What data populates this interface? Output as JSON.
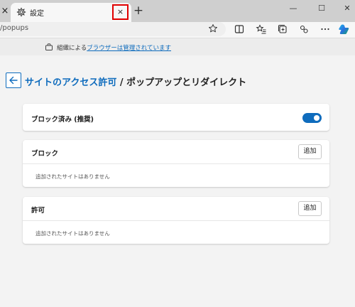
{
  "browser": {
    "tab_title": "設定",
    "tab_close_glyph": "×",
    "prev_tab_close_glyph": "×",
    "new_tab_glyph": "+",
    "url": "/popups",
    "window_minimize": "—",
    "window_maximize": "☐",
    "window_close": "✕"
  },
  "banner": {
    "prefix": "組織による",
    "link": "ブラウザーは管理されています"
  },
  "header": {
    "crumb_parent": "サイトのアクセス許可",
    "crumb_separator": " / ",
    "crumb_current": "ポップアップとリダイレクト"
  },
  "blocked_toggle": {
    "label": "ブロック済み (推奨)",
    "on": true
  },
  "block_section": {
    "title": "ブロック",
    "add_label": "追加",
    "empty_text": "追加されたサイトはありません"
  },
  "allow_section": {
    "title": "許可",
    "add_label": "追加",
    "empty_text": "追加されたサイトはありません"
  },
  "colors": {
    "accent": "#0f6cbd",
    "highlight_box": "#e00000"
  },
  "icons": [
    "gear-icon",
    "close-icon",
    "plus-icon",
    "star-icon",
    "split-screen-icon",
    "favorites-icon",
    "collections-icon",
    "extensions-icon",
    "more-icon",
    "copilot-icon",
    "briefcase-icon",
    "back-arrow-icon"
  ]
}
